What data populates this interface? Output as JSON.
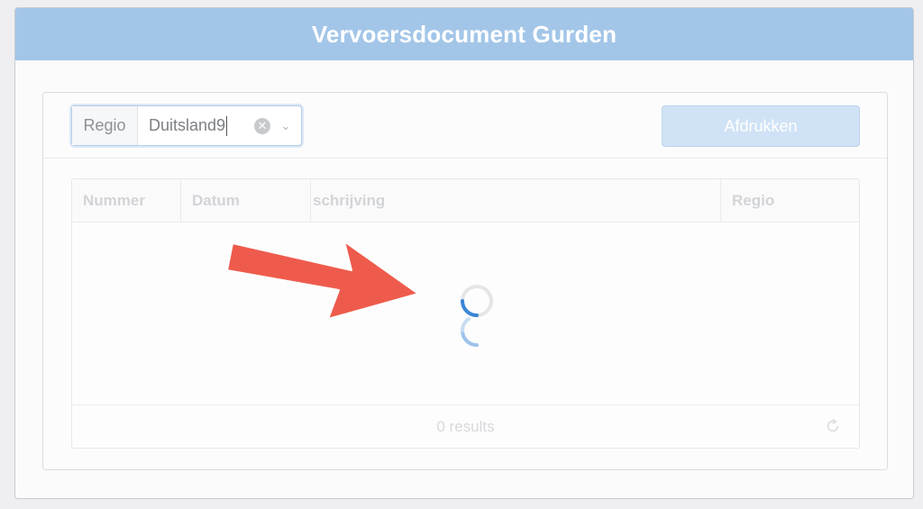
{
  "window": {
    "title": "Vervoersdocument Gurden"
  },
  "toolbar": {
    "region_label": "Regio",
    "region_value": "Duitsland9",
    "print_label": "Afdrukken"
  },
  "table": {
    "columns": [
      "Nummer",
      "Datum",
      "schrijving",
      "Regio"
    ],
    "footer_text": "0 results"
  },
  "colors": {
    "titlebar": "#a3c6e8",
    "accent": "#3a84d6",
    "arrow": "#ee5b4c"
  },
  "icons": {
    "clear": "circle-x-icon",
    "dropdown": "chevron-down-icon",
    "refresh": "refresh-icon",
    "loading": "spinner-icon",
    "annotation": "red-arrow-icon"
  }
}
